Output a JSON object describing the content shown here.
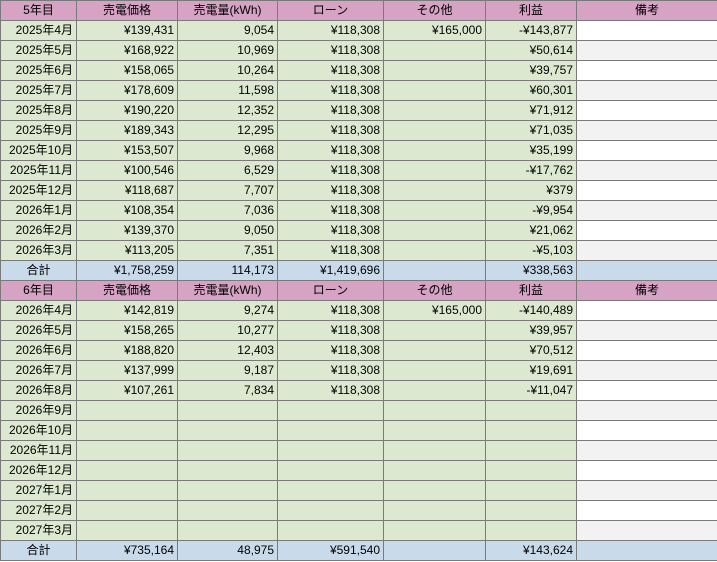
{
  "tables": [
    {
      "header": [
        "5年目",
        "売電価格",
        "売電量(kWh)",
        "ローン",
        "その他",
        "利益",
        "備考"
      ],
      "rows": [
        [
          "2025年4月",
          "¥139,431",
          "9,054",
          "¥118,308",
          "¥165,000",
          "-¥143,877",
          ""
        ],
        [
          "2025年5月",
          "¥168,922",
          "10,969",
          "¥118,308",
          "",
          "¥50,614",
          ""
        ],
        [
          "2025年6月",
          "¥158,065",
          "10,264",
          "¥118,308",
          "",
          "¥39,757",
          ""
        ],
        [
          "2025年7月",
          "¥178,609",
          "11,598",
          "¥118,308",
          "",
          "¥60,301",
          ""
        ],
        [
          "2025年8月",
          "¥190,220",
          "12,352",
          "¥118,308",
          "",
          "¥71,912",
          ""
        ],
        [
          "2025年9月",
          "¥189,343",
          "12,295",
          "¥118,308",
          "",
          "¥71,035",
          ""
        ],
        [
          "2025年10月",
          "¥153,507",
          "9,968",
          "¥118,308",
          "",
          "¥35,199",
          ""
        ],
        [
          "2025年11月",
          "¥100,546",
          "6,529",
          "¥118,308",
          "",
          "-¥17,762",
          ""
        ],
        [
          "2025年12月",
          "¥118,687",
          "7,707",
          "¥118,308",
          "",
          "¥379",
          ""
        ],
        [
          "2026年1月",
          "¥108,354",
          "7,036",
          "¥118,308",
          "",
          "-¥9,954",
          ""
        ],
        [
          "2026年2月",
          "¥139,370",
          "9,050",
          "¥118,308",
          "",
          "¥21,062",
          ""
        ],
        [
          "2026年3月",
          "¥113,205",
          "7,351",
          "¥118,308",
          "",
          "-¥5,103",
          ""
        ]
      ],
      "total": [
        "合計",
        "¥1,758,259",
        "114,173",
        "¥1,419,696",
        "",
        "¥338,563",
        ""
      ]
    },
    {
      "header": [
        "6年目",
        "売電価格",
        "売電量(kWh)",
        "ローン",
        "その他",
        "利益",
        "備考"
      ],
      "rows": [
        [
          "2026年4月",
          "¥142,819",
          "9,274",
          "¥118,308",
          "¥165,000",
          "-¥140,489",
          ""
        ],
        [
          "2026年5月",
          "¥158,265",
          "10,277",
          "¥118,308",
          "",
          "¥39,957",
          ""
        ],
        [
          "2026年6月",
          "¥188,820",
          "12,403",
          "¥118,308",
          "",
          "¥70,512",
          ""
        ],
        [
          "2026年7月",
          "¥137,999",
          "9,187",
          "¥118,308",
          "",
          "¥19,691",
          ""
        ],
        [
          "2026年8月",
          "¥107,261",
          "7,834",
          "¥118,308",
          "",
          "-¥11,047",
          ""
        ],
        [
          "2026年9月",
          "",
          "",
          "",
          "",
          "",
          ""
        ],
        [
          "2026年10月",
          "",
          "",
          "",
          "",
          "",
          ""
        ],
        [
          "2026年11月",
          "",
          "",
          "",
          "",
          "",
          ""
        ],
        [
          "2026年12月",
          "",
          "",
          "",
          "",
          "",
          ""
        ],
        [
          "2027年1月",
          "",
          "",
          "",
          "",
          "",
          ""
        ],
        [
          "2027年2月",
          "",
          "",
          "",
          "",
          "",
          ""
        ],
        [
          "2027年3月",
          "",
          "",
          "",
          "",
          "",
          ""
        ]
      ],
      "total": [
        "合計",
        "¥735,164",
        "48,975",
        "¥591,540",
        "",
        "¥143,624",
        ""
      ]
    }
  ]
}
